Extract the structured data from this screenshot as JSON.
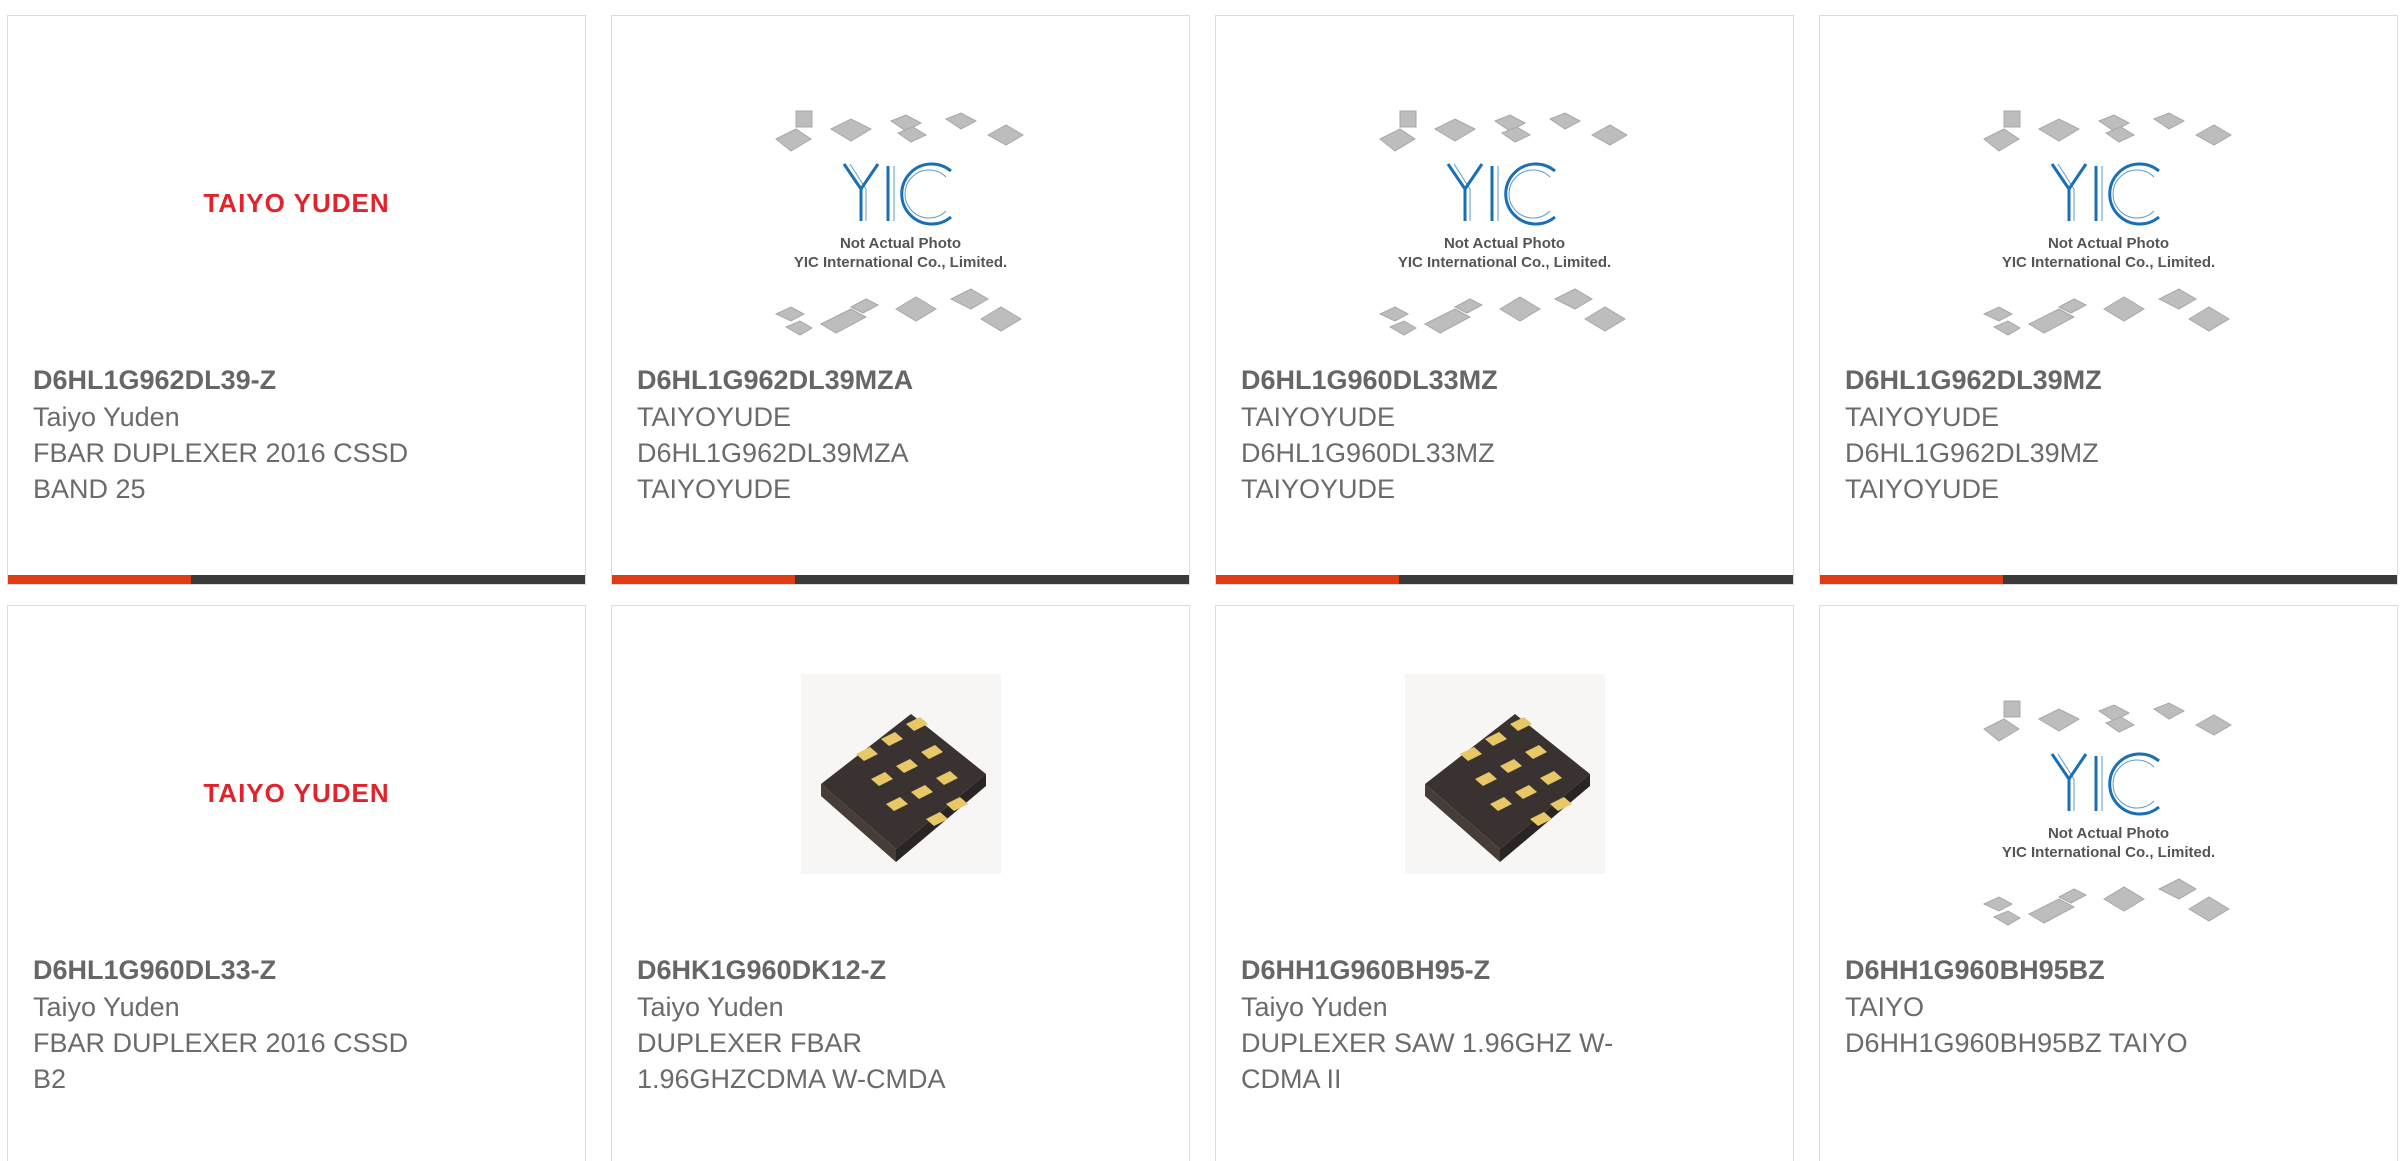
{
  "logo_text": "TAIYO YUDEN",
  "placeholder": {
    "line1": "Not Actual Photo",
    "line2": "YIC International Co., Limited."
  },
  "colors": {
    "accent": "#e03c14",
    "bar": "#3a3a3a",
    "logo": "#e1232b",
    "yic": "#1a6fb5"
  },
  "cards": [
    {
      "image": "taiyo-yuden-logo",
      "part": "D6HL1G962DL39-Z",
      "lines": [
        "Taiyo Yuden",
        "FBAR DUPLEXER 2016 CSSD",
        "BAND 25"
      ]
    },
    {
      "image": "yic-placeholder",
      "part": "D6HL1G962DL39MZA",
      "lines": [
        "TAIYOYUDE",
        "D6HL1G962DL39MZA",
        "TAIYOYUDE"
      ]
    },
    {
      "image": "yic-placeholder",
      "part": "D6HL1G960DL33MZ",
      "lines": [
        "TAIYOYUDE",
        "D6HL1G960DL33MZ",
        "TAIYOYUDE"
      ]
    },
    {
      "image": "yic-placeholder",
      "part": "D6HL1G962DL39MZ",
      "lines": [
        "TAIYOYUDE",
        "D6HL1G962DL39MZ",
        "TAIYOYUDE"
      ]
    },
    {
      "image": "taiyo-yuden-logo",
      "part": "D6HL1G960DL33-Z",
      "lines": [
        "Taiyo Yuden",
        "FBAR DUPLEXER 2016 CSSD",
        "B2"
      ]
    },
    {
      "image": "chip-photo",
      "part": "D6HK1G960DK12-Z",
      "lines": [
        "Taiyo Yuden",
        "DUPLEXER FBAR",
        "1.96GHZCDMA W-CMDA"
      ]
    },
    {
      "image": "chip-photo",
      "part": "D6HH1G960BH95-Z",
      "lines": [
        "Taiyo Yuden",
        "DUPLEXER SAW 1.96GHZ W-",
        "CDMA II"
      ]
    },
    {
      "image": "yic-placeholder",
      "part": "D6HH1G960BH95BZ",
      "lines": [
        "TAIYO",
        "D6HH1G960BH95BZ TAIYO"
      ]
    }
  ]
}
